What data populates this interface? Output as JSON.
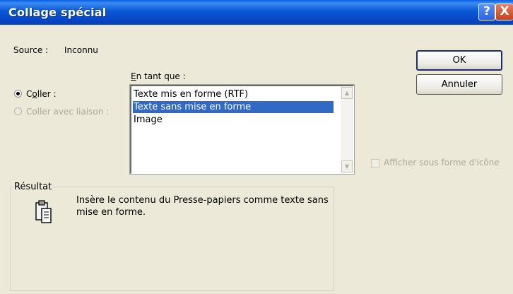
{
  "window": {
    "title": "Collage spécial",
    "help_glyph": "?",
    "close_glyph": "X"
  },
  "source": {
    "label": "Source :",
    "value": "Inconnu"
  },
  "as_label": "En tant que :",
  "options": [
    {
      "label": "Coller :",
      "checked": true,
      "enabled": true
    },
    {
      "label": "Coller avec liaison :",
      "checked": false,
      "enabled": false
    }
  ],
  "formats": [
    "Texte mis en forme (RTF)",
    "Texte sans mise en forme",
    "Image"
  ],
  "selected_format": "Texte sans mise en forme",
  "buttons": {
    "ok": "OK",
    "cancel": "Annuler"
  },
  "display_as_icon": {
    "label": "Afficher sous forme d'icône",
    "checked": false,
    "enabled": false
  },
  "result": {
    "label": "Résultat",
    "line1": "Insère le contenu du Presse-papiers comme texte sans",
    "line2": "mise en forme."
  },
  "icons": {
    "result": "clipboard-icon",
    "scroll_up": "scroll-up-arrow-icon",
    "scroll_down": "scroll-down-arrow-icon"
  }
}
